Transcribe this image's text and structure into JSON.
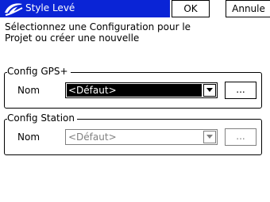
{
  "window": {
    "title": "Style Levé",
    "icon": "trimble-app-icon",
    "ok_label": "OK",
    "cancel_label": "Annule"
  },
  "instructions": "Sélectionnez une Configuration pour le\nProjet ou créer une nouvelle",
  "gps_group": {
    "legend": "Config GPS+",
    "nom_label": "Nom",
    "selected_value": "<Défaut>",
    "browse_label": "..."
  },
  "station_group": {
    "legend": "Config Station",
    "nom_label": "Nom",
    "selected_value": "<Défaut>",
    "browse_label": "...",
    "disabled": true
  },
  "colors": {
    "title_bar": "#0a24d6",
    "disabled_text": "#808080"
  }
}
